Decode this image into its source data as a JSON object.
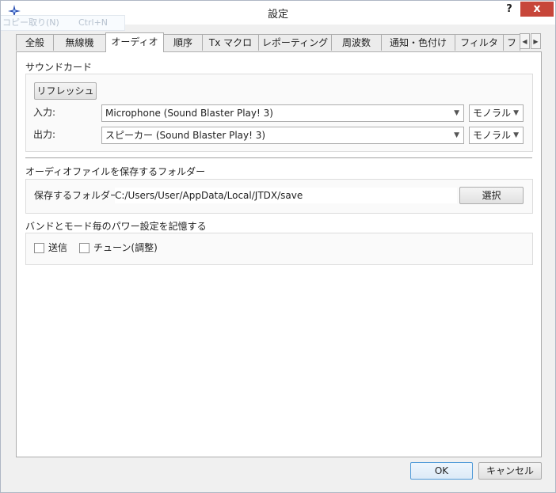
{
  "window": {
    "title": "設定",
    "help": "?",
    "close": "x",
    "ghost_menu": {
      "label": "コピー取り(N)",
      "shortcut": "Ctrl+N"
    }
  },
  "tabs": [
    {
      "label": "全般"
    },
    {
      "label": "無線機"
    },
    {
      "label": "オーディオ",
      "active": true
    },
    {
      "label": "順序"
    },
    {
      "label": "Tx マクロ"
    },
    {
      "label": "レポーティング"
    },
    {
      "label": "周波数"
    },
    {
      "label": "通知・色付け"
    },
    {
      "label": "フィルタ"
    },
    {
      "label": "フ"
    }
  ],
  "tab_scroll": {
    "left": "◀",
    "right": "▶"
  },
  "soundcard": {
    "title": "サウンドカード",
    "refresh_label": "リフレッシュ",
    "input_label": "入力:",
    "input_device": "Microphone (Sound Blaster Play! 3)",
    "input_channel": "モノラル",
    "output_label": "出力:",
    "output_device": "スピーカー (Sound Blaster Play! 3)",
    "output_channel": "モノラル",
    "arrow": "▼"
  },
  "save_folder": {
    "title": "オーディオファイルを保存するフォルダー",
    "label": "保存するフォルダー:",
    "path": "C:/Users/User/AppData/Local/JTDX/save",
    "select_label": "選択"
  },
  "power": {
    "title": "バンドとモード毎のパワー設定を記憶する",
    "transmit_label": "送信",
    "tune_label": "チューン(調整)"
  },
  "footer": {
    "ok_label": "OK",
    "cancel_label": "キャンセル"
  }
}
